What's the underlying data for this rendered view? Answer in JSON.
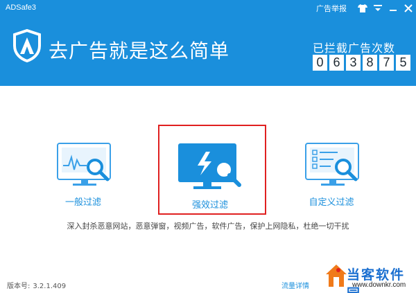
{
  "app": {
    "title": "ADSafe3",
    "report_label": "广告举报"
  },
  "header": {
    "slogan": "去广告就是这么简单",
    "counter_label": "已拦截广告次数",
    "counter_digits": [
      "0",
      "6",
      "3",
      "8",
      "7",
      "5"
    ]
  },
  "options": [
    {
      "label": "一般过滤",
      "icon": "monitor-chart-search-icon"
    },
    {
      "label": "强效过滤",
      "icon": "monitor-lightning-search-icon",
      "selected": true
    },
    {
      "label": "自定义过滤",
      "icon": "monitor-checklist-search-icon"
    }
  ],
  "description": "深入封杀恶意网站，恶意弹窗，视频广告，软件广告，保护上网隐私，杜绝一切干扰",
  "footer": {
    "version_label": "版本号:",
    "version_value": "3.2.1.409",
    "traffic_link": "流量详情"
  },
  "watermark": {
    "name": "当客软件园",
    "url": "www.downkr.com"
  },
  "colors": {
    "brand_blue": "#1a8fdc",
    "selection_red": "#e02020"
  }
}
